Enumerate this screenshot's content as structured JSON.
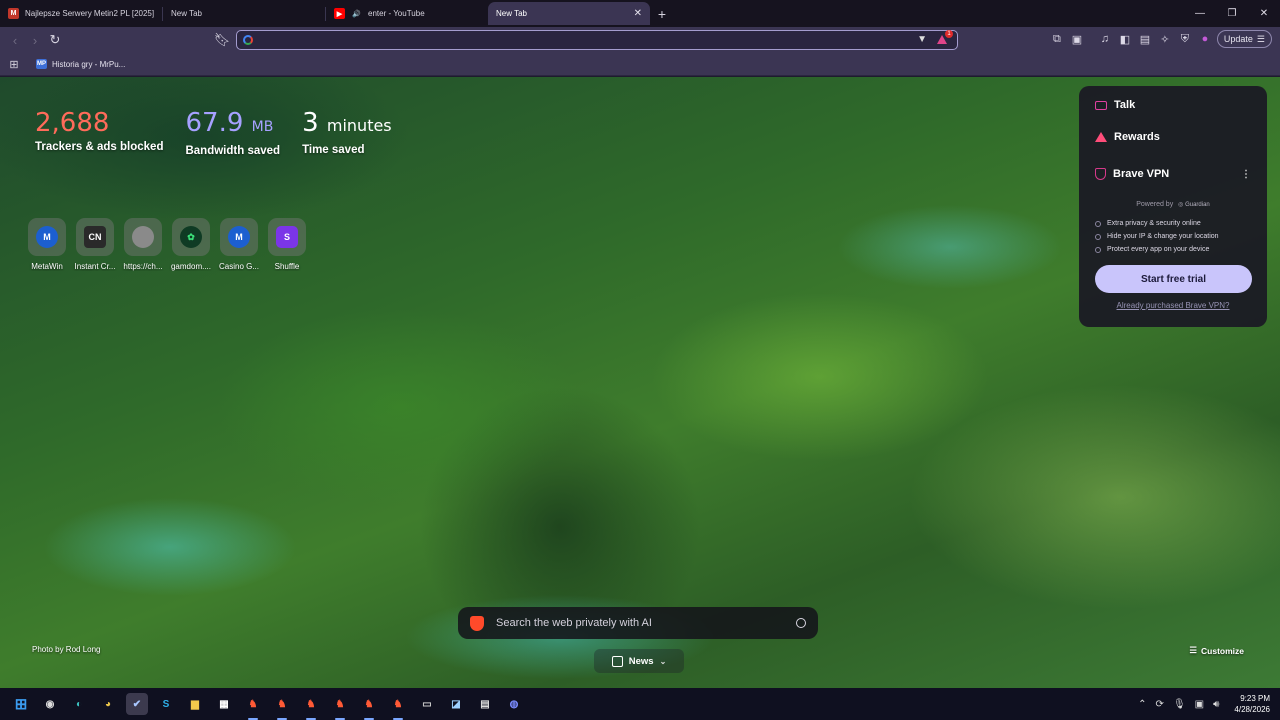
{
  "tabs": [
    {
      "title": "Najlepsze Serwery Metin2 PL [2025]",
      "favicon": "M2",
      "favicon_color": "#c2372b"
    },
    {
      "title": "New Tab",
      "favicon": "",
      "favicon_color": ""
    },
    {
      "title": "enter - YouTube",
      "favicon": "youtube-icon",
      "favicon_color": "#ff0000"
    },
    {
      "title": "New Tab",
      "favicon": "",
      "favicon_color": ""
    }
  ],
  "toolbar": {
    "omnibox_value": "",
    "rewards_badge": "1",
    "update_label": "Update"
  },
  "bookmarks": [
    {
      "label": "Historia gry - MrPu...",
      "favicon": "MP"
    }
  ],
  "stats": {
    "trackers_value": "2,688",
    "trackers_label": "Trackers & ads blocked",
    "bandwidth_value": "67.9",
    "bandwidth_unit": "MB",
    "bandwidth_label": "Bandwidth saved",
    "time_value": "3",
    "time_unit": "minutes",
    "time_label": "Time saved"
  },
  "top_sites": [
    {
      "label": "MetaWin",
      "logo": "M",
      "color": "#1c5fd0"
    },
    {
      "label": "Instant Cr...",
      "logo": "CN",
      "color": "#2a2a2a"
    },
    {
      "label": "https://ch...",
      "logo": "",
      "color": "#8a8a8a"
    },
    {
      "label": "gamdom....",
      "logo": "G",
      "color": "#0f3b24"
    },
    {
      "label": "Casino G...",
      "logo": "M",
      "color": "#1c5fd0"
    },
    {
      "label": "Shuffle",
      "logo": "S",
      "color": "#7b35e8"
    }
  ],
  "card": {
    "talk": "Talk",
    "rewards": "Rewards",
    "vpn": "Brave VPN",
    "powered_by": "Powered by",
    "guardian": "Guardian",
    "features": [
      "Extra privacy & security online",
      "Hide your IP & change your location",
      "Protect every app on your device"
    ],
    "trial_button": "Start free trial",
    "purchased_link": "Already purchased Brave VPN?"
  },
  "search": {
    "placeholder": "Search the web privately with AI"
  },
  "news": {
    "label": "News"
  },
  "photo_credit": "Photo by Rod Long",
  "customize": "Customize",
  "clock": {
    "time": "9:23 PM",
    "date": "4/28/2026"
  }
}
